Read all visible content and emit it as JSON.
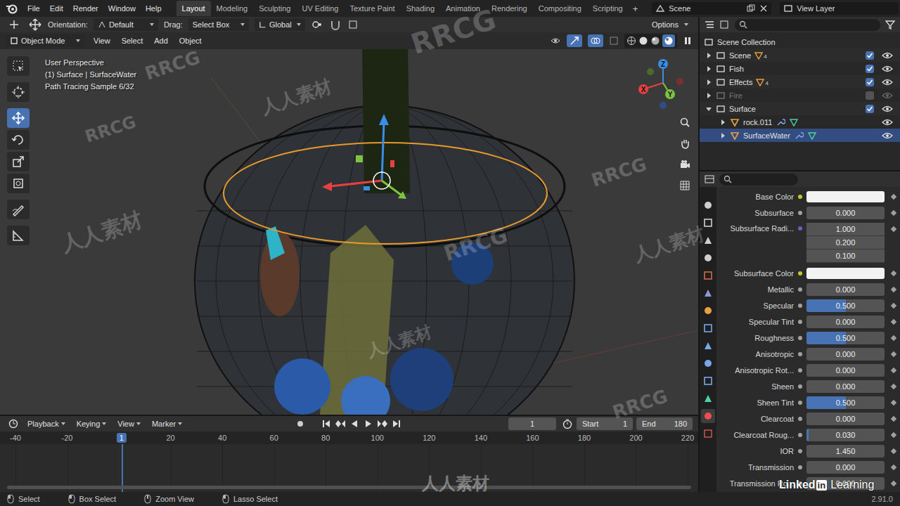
{
  "topbar": {
    "menu": [
      "File",
      "Edit",
      "Render",
      "Window",
      "Help"
    ],
    "workspaces": [
      {
        "label": "Layout",
        "selected": true
      },
      {
        "label": "Modeling",
        "selected": false
      },
      {
        "label": "Sculpting",
        "selected": false
      },
      {
        "label": "UV Editing",
        "selected": false
      },
      {
        "label": "Texture Paint",
        "selected": false
      },
      {
        "label": "Shading",
        "selected": false
      },
      {
        "label": "Animation",
        "selected": false
      },
      {
        "label": "Rendering",
        "selected": false
      },
      {
        "label": "Compositing",
        "selected": false
      },
      {
        "label": "Scripting",
        "selected": false
      }
    ],
    "add_workspace": "+",
    "scene": "Scene",
    "view_layer": "View Layer"
  },
  "tool_header": {
    "orientation_label": "Orientation:",
    "orientation": "Default",
    "drag_label": "Drag:",
    "drag": "Select Box",
    "transform_space": "Global",
    "options": "Options"
  },
  "view_header": {
    "mode": "Object Mode",
    "menus": [
      "View",
      "Select",
      "Add",
      "Object"
    ]
  },
  "viewport": {
    "info": [
      "User Perspective",
      "(1) Surface | SurfaceWater",
      "Path Tracing Sample 6/32"
    ],
    "axes": [
      "X",
      "Y",
      "Z"
    ],
    "tools": [
      {
        "selected": false
      },
      {
        "selected": false
      },
      {
        "selected": true
      },
      {
        "selected": false
      },
      {
        "selected": false
      },
      {
        "selected": false
      },
      {
        "selected": false
      },
      {
        "selected": false
      }
    ]
  },
  "outliner": {
    "root": "Scene Collection",
    "items": [
      {
        "name": "Scene",
        "kind": "collection",
        "expanded": false,
        "excluded": false,
        "checked": true,
        "visible": true,
        "selected": false,
        "badge": "4",
        "children": []
      },
      {
        "name": "Fish",
        "kind": "collection",
        "expanded": false,
        "excluded": false,
        "checked": true,
        "visible": true,
        "selected": false,
        "badge": "",
        "children": []
      },
      {
        "name": "Effects",
        "kind": "collection",
        "expanded": false,
        "excluded": false,
        "checked": true,
        "visible": true,
        "selected": false,
        "badge": "4",
        "children": []
      },
      {
        "name": "Fire",
        "kind": "collection",
        "expanded": false,
        "excluded": true,
        "checked": false,
        "visible": false,
        "selected": false,
        "badge": "",
        "children": []
      },
      {
        "name": "Surface",
        "kind": "collection",
        "expanded": true,
        "excluded": false,
        "checked": true,
        "visible": true,
        "selected": false,
        "badge": "",
        "children": [
          {
            "name": "rock.011",
            "kind": "object",
            "selected": false,
            "visible": true
          },
          {
            "name": "SurfaceWater",
            "kind": "object",
            "selected": true,
            "visible": true
          }
        ]
      }
    ]
  },
  "properties": [
    {
      "kind": "color",
      "label": "Base Color",
      "color": "#f2f2f2"
    },
    {
      "kind": "slider",
      "label": "Subsurface",
      "value": "0.000",
      "level": 0
    },
    {
      "kind": "vector",
      "label": "Subsurface Radi...",
      "values": [
        "1.000",
        "0.200",
        "0.100"
      ]
    },
    {
      "kind": "color",
      "label": "Subsurface Color",
      "color": "#f2f2f2"
    },
    {
      "kind": "slider",
      "label": "Metallic",
      "value": "0.000",
      "level": 0
    },
    {
      "kind": "slider",
      "label": "Specular",
      "value": "0.500",
      "level": 0.5
    },
    {
      "kind": "slider",
      "label": "Specular Tint",
      "value": "0.000",
      "level": 0
    },
    {
      "kind": "slider",
      "label": "Roughness",
      "value": "0.500",
      "level": 0.5
    },
    {
      "kind": "slider",
      "label": "Anisotropic",
      "value": "0.000",
      "level": 0
    },
    {
      "kind": "slider",
      "label": "Anisotropic Rot...",
      "value": "0.000",
      "level": 0
    },
    {
      "kind": "slider",
      "label": "Sheen",
      "value": "0.000",
      "level": 0
    },
    {
      "kind": "slider",
      "label": "Sheen Tint",
      "value": "0.500",
      "level": 0.5
    },
    {
      "kind": "slider",
      "label": "Clearcoat",
      "value": "0.000",
      "level": 0
    },
    {
      "kind": "slider",
      "label": "Clearcoat Roug...",
      "value": "0.030",
      "level": 0.03
    },
    {
      "kind": "number",
      "label": "IOR",
      "value": "1.450"
    },
    {
      "kind": "slider",
      "label": "Transmission",
      "value": "0.000",
      "level": 0
    },
    {
      "kind": "slider",
      "label": "Transmission Ro...",
      "value": "0.000",
      "level": 0
    }
  ],
  "timeline": {
    "menus": [
      "Playback",
      "Keying",
      "View",
      "Marker"
    ],
    "current_frame": "1",
    "start_label": "Start",
    "start": "1",
    "end_label": "End",
    "end": "180",
    "ruler": [
      {
        "label": "-40",
        "current": false
      },
      {
        "label": "-20",
        "current": false
      },
      {
        "label": "1",
        "current": true
      },
      {
        "label": "20",
        "current": false
      },
      {
        "label": "40",
        "current": false
      },
      {
        "label": "60",
        "current": false
      },
      {
        "label": "80",
        "current": false
      },
      {
        "label": "100",
        "current": false
      },
      {
        "label": "120",
        "current": false
      },
      {
        "label": "140",
        "current": false
      },
      {
        "label": "160",
        "current": false
      },
      {
        "label": "180",
        "current": false
      },
      {
        "label": "200",
        "current": false
      },
      {
        "label": "220",
        "current": false
      }
    ]
  },
  "status_bar": {
    "items": [
      "Select",
      "Box Select",
      "Zoom View",
      "Lasso Select"
    ],
    "version": "2.91.0"
  },
  "watermarks": {
    "brand": "RRCG",
    "brand_cn": "人人素材",
    "learning": [
      "Linked",
      "in",
      "Learning"
    ]
  }
}
